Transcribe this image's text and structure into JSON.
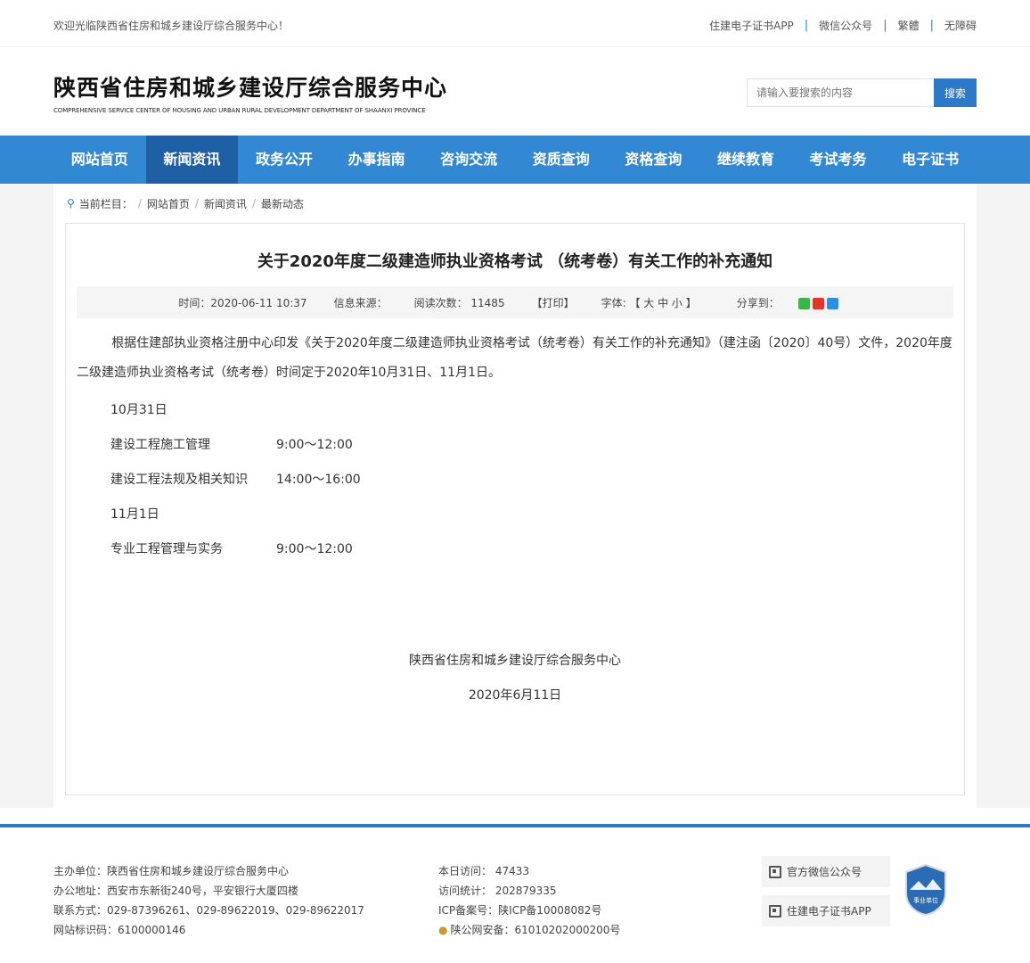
{
  "topbar": {
    "welcome": "欢迎光临陕西省住房和城乡建设厅综合服务中心！",
    "links": [
      "住建电子证书APP",
      "微信公众号",
      "繁體",
      "无障碍"
    ],
    "separator": "|"
  },
  "header": {
    "title": "陕西省住房和城乡建设厅综合服务中心",
    "subtitle": "COMPREHENSIVE SERVICE CENTER OF HOUSING AND URBAN RURAL DEVELOPMENT DEPARTMENT OF SHAANXI PROVINCE",
    "search_placeholder": "请输入要搜索的内容",
    "search_button": "搜索"
  },
  "nav": {
    "items": [
      "网站首页",
      "新闻资讯",
      "政务公开",
      "办事指南",
      "咨询交流",
      "资质查询",
      "资格查询",
      "继续教育",
      "考试考务",
      "电子证书"
    ],
    "active_index": 1
  },
  "breadcrumb": {
    "label": "当前栏目：",
    "items": [
      "网站首页",
      "新闻资讯",
      "最新动态"
    ]
  },
  "article": {
    "title": "关于2020年度二级建造师执业资格考试 （统考卷）有关工作的补充通知",
    "meta": {
      "time": "时间：2020-06-11 10:37",
      "source": "信息来源：",
      "views": "阅读次数： 11485",
      "print": "【打印】",
      "font": "字体: 【 大 中 小 】",
      "share": "分享到："
    },
    "paragraph": "根据住建部执业资格注册中心印发《关于2020年度二级建造师执业资格考试（统考卷）有关工作的补充通知》（建注函〔2020〕40号）文件，2020年度二级建造师执业资格考试（统考卷）时间定于2020年10月31日、11月1日。",
    "day1": "10月31日",
    "day1_rows": [
      {
        "subject": "建设工程施工管理",
        "time": "9:00～12:00"
      },
      {
        "subject": "建设工程法规及相关知识",
        "time": "14:00～16:00"
      }
    ],
    "day2": "11月1日",
    "day2_rows": [
      {
        "subject": "专业工程管理与实务",
        "time": "9:00～12:00"
      }
    ],
    "signoff_org": "陕西省住房和城乡建设厅综合服务中心",
    "signoff_date": "2020年6月11日"
  },
  "footer": {
    "col1": [
      "主办单位：陕西省住房和城乡建设厅综合服务中心",
      "办公地址：西安市东新街240号，平安银行大厦四楼",
      "联系方式：029-87396261、029-89622019、029-89622017",
      "网站标识码：6100000146"
    ],
    "col2": [
      "本日访问： 47433",
      "访问统计： 202879335",
      "ICP备案号：陕ICP备10008082号",
      "陕公网安备：61010202000200号"
    ],
    "qr_buttons": [
      "官方微信公众号",
      "住建电子证书APP"
    ],
    "badge_text": "事业单位"
  },
  "colors": {
    "nav_bg": "#3388d4",
    "nav_active": "#1f5fa3",
    "accent": "#2c79c8"
  }
}
